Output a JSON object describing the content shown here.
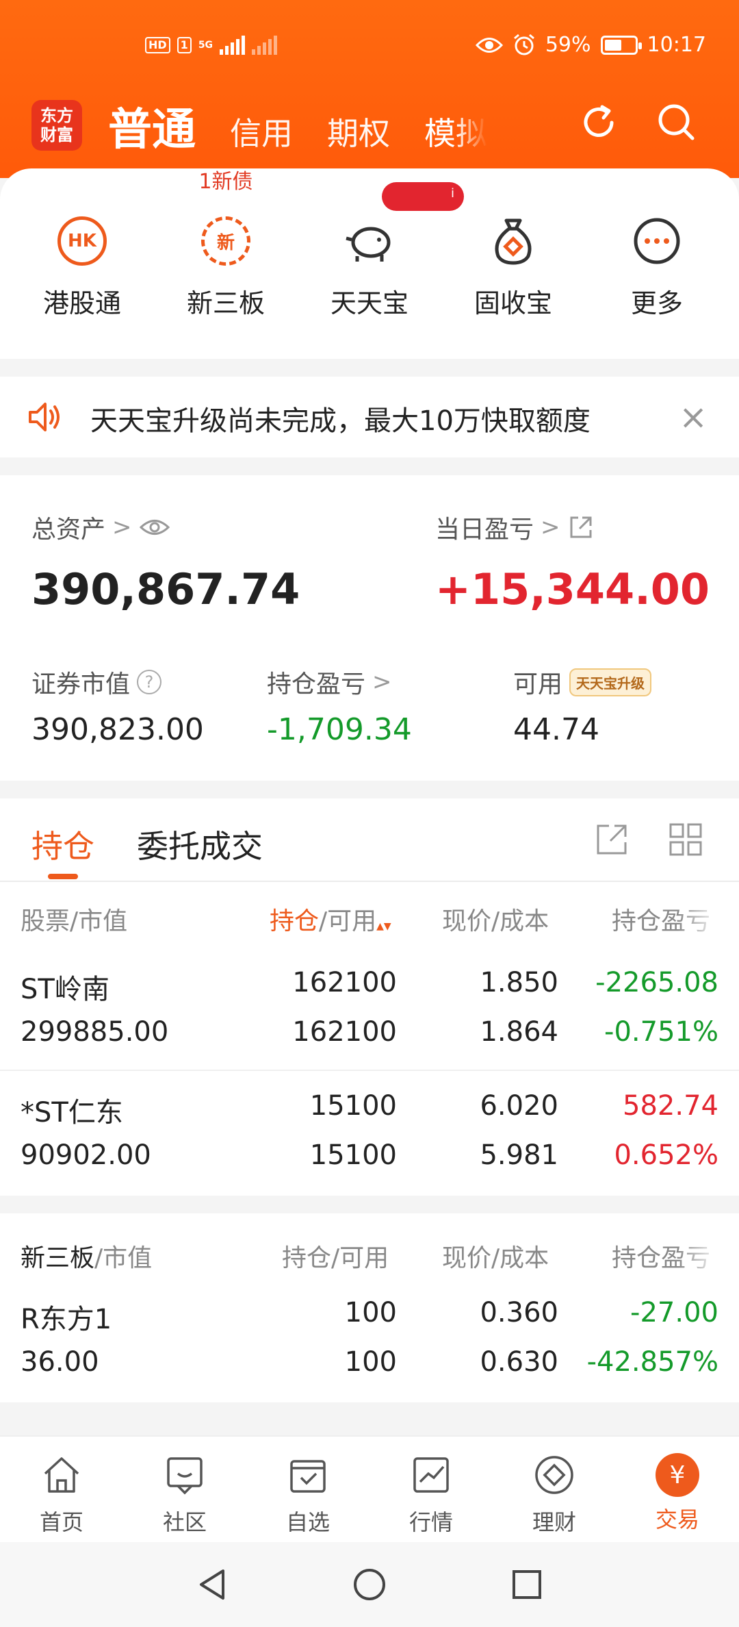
{
  "status_bar": {
    "left_tags": [
      "HD",
      "1"
    ],
    "network": "5G",
    "battery_text": "59%",
    "battery_level": 0.59,
    "time": "10:17"
  },
  "nav": {
    "logo_line1": "东方",
    "logo_line2": "财富",
    "tabs": [
      "普通",
      "信用",
      "期权",
      "模拟"
    ],
    "icons": [
      "refresh-icon",
      "search-icon"
    ]
  },
  "shortcuts": [
    {
      "label": "港股通",
      "icon_text": "HK",
      "icon": "hk-icon"
    },
    {
      "label": "新三板",
      "icon_text": "新",
      "icon": "new-board-icon",
      "badge": "1新债"
    },
    {
      "label": "天天宝",
      "icon": "piggy-bank-icon",
      "badge_tag": "i"
    },
    {
      "label": "固收宝",
      "icon": "money-bag-icon"
    },
    {
      "label": "更多",
      "icon": "more-icon"
    }
  ],
  "notice": {
    "text": "天天宝升级尚未完成，最大10万快取额度",
    "close": "×"
  },
  "assets": {
    "total_label": "总资产",
    "total_value": "390,867.74",
    "daily_label": "当日盈亏",
    "daily_value": "+15,344.00",
    "market_value_label": "证券市值",
    "market_value": "390,823.00",
    "holding_pnl_label": "持仓盈亏",
    "holding_pnl": "-1,709.34",
    "available_label": "可用",
    "available_badge": "天天宝升级",
    "available_value": "44.74",
    "chevron": ">",
    "qmark": "?"
  },
  "positions": {
    "tabs": [
      "持仓",
      "委托成交"
    ],
    "headers": {
      "stock": "股票",
      "stock_sub": "/市值",
      "hold": "持仓",
      "hold_sub": "/可用",
      "sort": "▲▼",
      "price": "现价/成本",
      "pnl": "持仓盈亏"
    },
    "rows": [
      {
        "name": "ST岭南",
        "market_value": "299885.00",
        "hold": "162100",
        "available": "162100",
        "price": "1.850",
        "cost": "1.864",
        "pnl": "-2265.08",
        "pnl_pct": "-0.751%",
        "color": "#149a2a"
      },
      {
        "name": "*ST仁东",
        "market_value": "90902.00",
        "hold": "15100",
        "available": "15100",
        "price": "6.020",
        "cost": "5.981",
        "pnl": "582.74",
        "pnl_pct": "0.652%",
        "color": "#e2252f"
      }
    ]
  },
  "xsb": {
    "headers": {
      "stock": "新三板",
      "stock_sub": "/市值",
      "hold": "持仓/可用",
      "price": "现价/成本",
      "pnl": "持仓盈亏"
    },
    "rows": [
      {
        "name": "R东方1",
        "market_value": "36.00",
        "hold": "100",
        "available": "100",
        "price": "0.360",
        "cost": "0.630",
        "pnl": "-27.00",
        "pnl_pct": "-42.857%",
        "color": "#149a2a"
      }
    ]
  },
  "tabbar": [
    {
      "label": "首页",
      "icon": "home-icon"
    },
    {
      "label": "社区",
      "icon": "community-icon"
    },
    {
      "label": "自选",
      "icon": "watchlist-icon"
    },
    {
      "label": "行情",
      "icon": "market-icon"
    },
    {
      "label": "理财",
      "icon": "wealth-icon"
    },
    {
      "label": "交易",
      "icon": "trade-icon",
      "icon_text": "¥",
      "active": true
    }
  ],
  "colors": {
    "brand_orange": "#ff5a0a",
    "accent": "#ee5a1c",
    "gain": "#e2252f",
    "loss": "#149a2a"
  }
}
